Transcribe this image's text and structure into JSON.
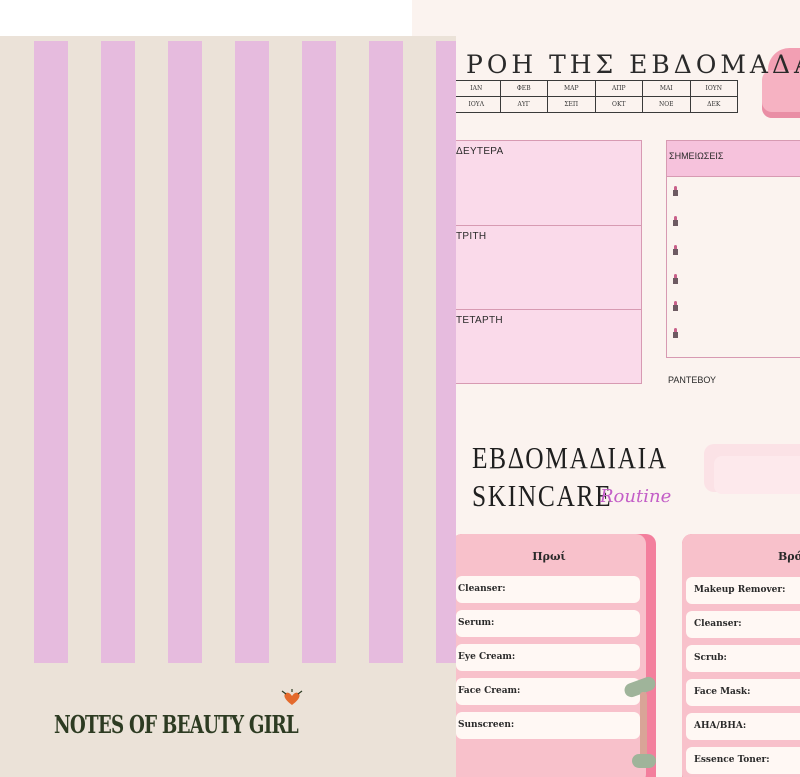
{
  "planner": {
    "week_title": "ΡΟΗ ΤΗΣ ΕΒΔΟΜΑΔΑΣ",
    "months_row1": [
      "ΙΑΝ",
      "ΦΕΒ",
      "ΜΑΡ",
      "ΑΠΡ",
      "ΜΑΙ",
      "ΙΟΥΝ"
    ],
    "months_row2": [
      "ΙΟΥΛ",
      "ΑΥΓ",
      "ΣΕΠ",
      "ΟΚΤ",
      "ΝΟΕ",
      "ΔΕΚ"
    ],
    "days": [
      "ΔΕΥΤΕΡΑ",
      "ΤΡΙΤΗ",
      "ΤΕΤΑΡΤΗ"
    ],
    "notes_label": "ΣΗΜΕΙΩΣΕΙΣ",
    "rendezvous_label": "ΡΑΝΤΕΒΟΥ"
  },
  "skincare": {
    "title_line1": "ΕΒΔΟΜΑΔΙΑΙΑ",
    "title_line2": "SKINCARE",
    "title_script": "Routine",
    "morning": {
      "title": "Πρωί",
      "fields": [
        "Cleanser:",
        "Serum:",
        "Eye Cream:",
        "Face Cream:",
        "Sunscreen:"
      ]
    },
    "evening": {
      "title": "Βράδυ",
      "fields": [
        "Makeup Remover:",
        "Cleanser:",
        "Scrub:",
        "Face Mask:",
        "AHA/BHA:",
        "Essence Toner:"
      ]
    }
  },
  "cover": {
    "title": "NOTES OF BEAUTY GIRL"
  },
  "colors": {
    "stripe": "#e6bbde",
    "cover_bg": "#ebe2d8",
    "card_pink": "#f8c1cb",
    "accent_purple": "#c35ec7"
  }
}
